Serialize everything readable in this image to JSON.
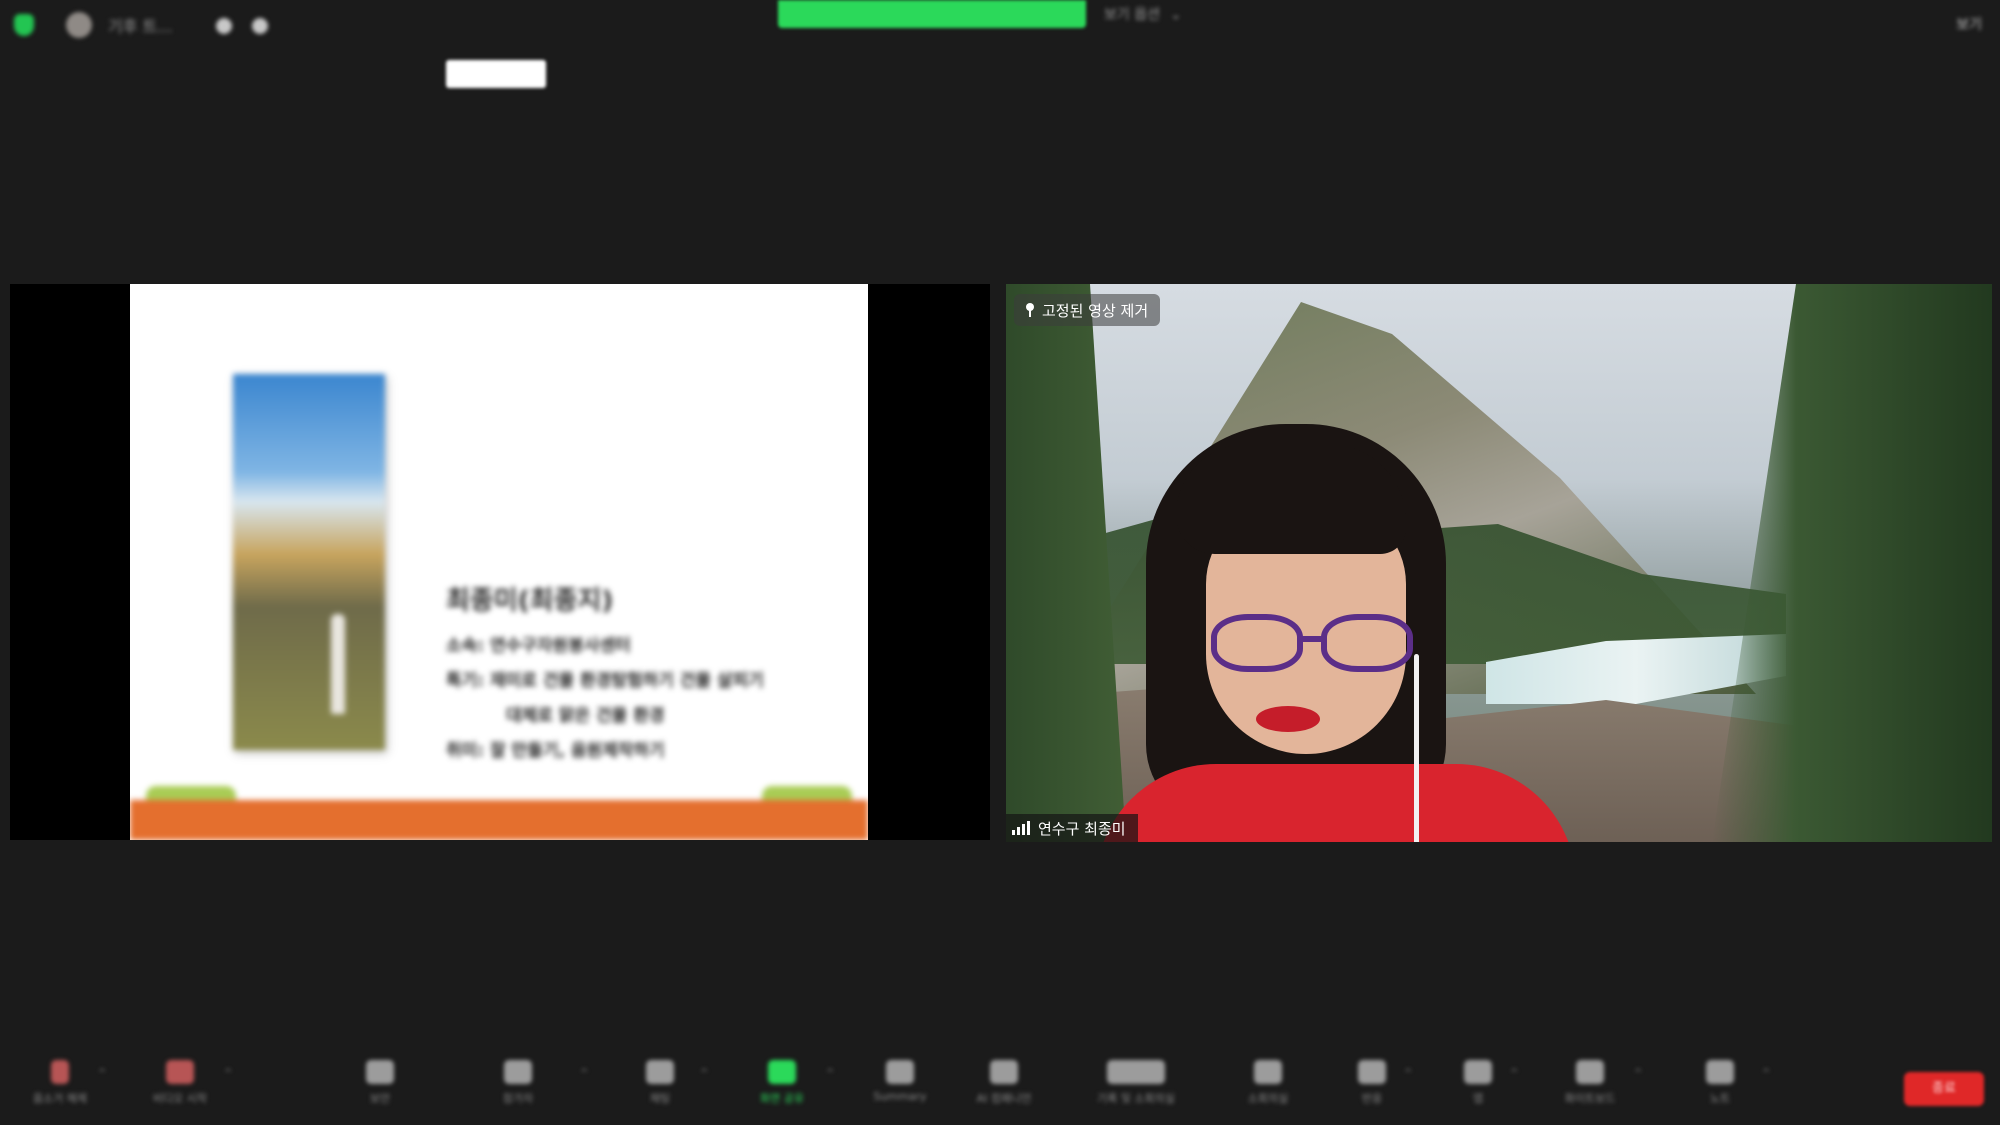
{
  "top_bar": {
    "host_name": "기후 트...",
    "share_banner": "",
    "view_options_label": "보기 옵션",
    "view_button_label": "보기"
  },
  "pill_label": "",
  "shared_slide": {
    "title": "최종미(최종지)",
    "lines": [
      "소속: 연수구자원봉사센터",
      "특기: 재미로 건물 환경탐험하기 건물 살피기",
      "대체로 맑은 건물 환경",
      "취미: 잘 만들기, 음원제작하기"
    ]
  },
  "video_tile": {
    "unpin_label": "고정된 영상 제거",
    "participant_name": "연수구 최종미"
  },
  "toolbar": {
    "items": [
      {
        "label": "음소거 해제"
      },
      {
        "label": "비디오 시작"
      },
      {
        "label": "보안"
      },
      {
        "label": "참가자"
      },
      {
        "label": "채팅"
      },
      {
        "label": "화면 공유"
      },
      {
        "label": "Summary"
      },
      {
        "label": "AI 컴패니언"
      },
      {
        "label": "기록 및 소회의실"
      },
      {
        "label": "소회의실"
      },
      {
        "label": "반응"
      },
      {
        "label": "앱"
      },
      {
        "label": "화이트보드"
      },
      {
        "label": "노트"
      }
    ],
    "end_label": "종료"
  },
  "colors": {
    "background": "#1b1b1b",
    "share_green": "#2bd95a",
    "end_red": "#e02828"
  }
}
